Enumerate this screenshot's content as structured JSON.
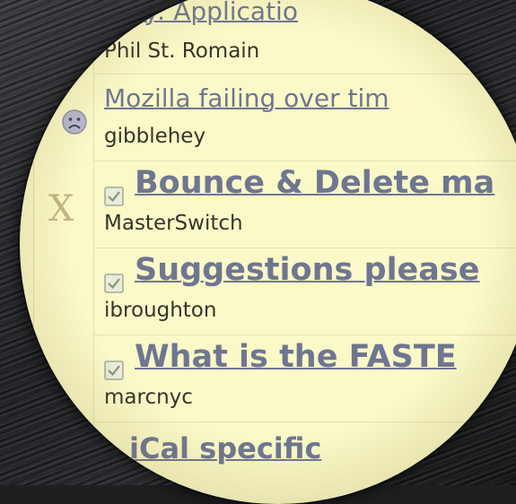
{
  "threads": [
    {
      "title": "icky: Applicatio",
      "author": "Phil St. Romain",
      "style": "link"
    },
    {
      "title": "Mozilla failing over tim",
      "author": "gibblehey",
      "style": "link"
    },
    {
      "title": "Bounce & Delete ma",
      "author": "MasterSwitch",
      "style": "bold",
      "flag": "X"
    },
    {
      "title": "Suggestions please",
      "author": "ibroughton",
      "style": "bold"
    },
    {
      "title": "What is the FASTE",
      "author": "marcnyc",
      "style": "bold"
    },
    {
      "title": "iCal specific",
      "author": "",
      "style": "bold"
    }
  ],
  "icons": {
    "mood": "sad-face-icon",
    "read": "checkbox-check-icon"
  },
  "colors": {
    "background": "#fbf9c8",
    "link": "#6f7691",
    "text": "#34352c"
  }
}
